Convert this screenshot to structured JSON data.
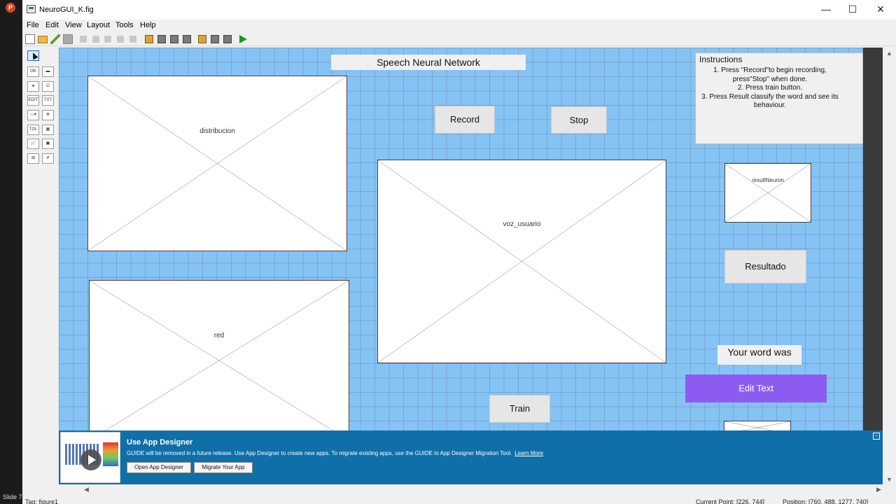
{
  "window": {
    "title": "NeuroGUI_K.fig",
    "controls": {
      "minimize": "—",
      "maximize": "☐",
      "close": "✕"
    }
  },
  "presentation": {
    "app_icon_letter": "P",
    "slide_label": "Slide 7"
  },
  "menu": [
    "File",
    "Edit",
    "View",
    "Layout",
    "Tools",
    "Help"
  ],
  "toolbar_icons": [
    "new-icon",
    "open-icon",
    "edit-icon",
    "save-icon",
    "cut-icon",
    "copy-icon",
    "paste-icon",
    "undo-icon",
    "redo-icon",
    "align-icon",
    "menu-editor-icon",
    "tab-order-icon",
    "toolbar-editor-icon",
    "editor-icon",
    "property-inspector-icon",
    "object-browser-icon",
    "run-icon"
  ],
  "palette": [
    {
      "name": "select-tool",
      "glyph": ""
    },
    {
      "name": "push-button-tool",
      "glyph": "OK"
    },
    {
      "name": "slider-tool",
      "glyph": "▬"
    },
    {
      "name": "radio-button-tool",
      "glyph": "●"
    },
    {
      "name": "checkbox-tool",
      "glyph": "☑"
    },
    {
      "name": "edit-text-tool",
      "glyph": "EDIT"
    },
    {
      "name": "static-text-tool",
      "glyph": "TXT"
    },
    {
      "name": "popup-menu-tool",
      "glyph": "▭▾"
    },
    {
      "name": "listbox-tool",
      "glyph": "≣"
    },
    {
      "name": "toggle-button-tool",
      "glyph": "TGL"
    },
    {
      "name": "table-tool",
      "glyph": "▦"
    },
    {
      "name": "axes-tool",
      "glyph": "📈"
    },
    {
      "name": "panel-tool",
      "glyph": "▣"
    },
    {
      "name": "button-group-tool",
      "glyph": "⊞"
    },
    {
      "name": "activex-tool",
      "glyph": "✗"
    }
  ],
  "canvas": {
    "title": "Speech Neural Network",
    "axes": {
      "distribucion": "distribucion",
      "red": "red",
      "voz_usuario": "voz_usuario",
      "resultNeuron": "resultNeuron",
      "bottom": ""
    },
    "buttons": {
      "record": "Record",
      "stop": "Stop",
      "train": "Train",
      "resultado": "Resultado"
    },
    "instructions": {
      "title": "Instructions",
      "lines": [
        "1. Press \"Record\"to begin recording, press\"Stop\" when done.",
        "2. Press train button.",
        "3. Press Result classify the word and see its behaviour."
      ]
    },
    "your_word_label": "Your word was",
    "edit_text": "Edit Text"
  },
  "banner": {
    "title": "Use App Designer",
    "message": "GUIDE will be removed in a future release. Use App Designer to create new apps. To migrate existing apps, use the GUIDE to App Designer Migration Tool.",
    "link": "Learn More",
    "btn_open": "Open App Designer",
    "btn_migrate": "Migrate Your App",
    "collapse": "–"
  },
  "status": {
    "tag": "Tag: figure1",
    "current_point": "Current Point: [226, 744]",
    "position": "Position: [760, 488, 1277, 740]"
  },
  "colors": {
    "canvas_bg": "#86c3f5",
    "edit_text_bg": "#8c5cf2",
    "banner_bg": "#0f6fa8"
  }
}
